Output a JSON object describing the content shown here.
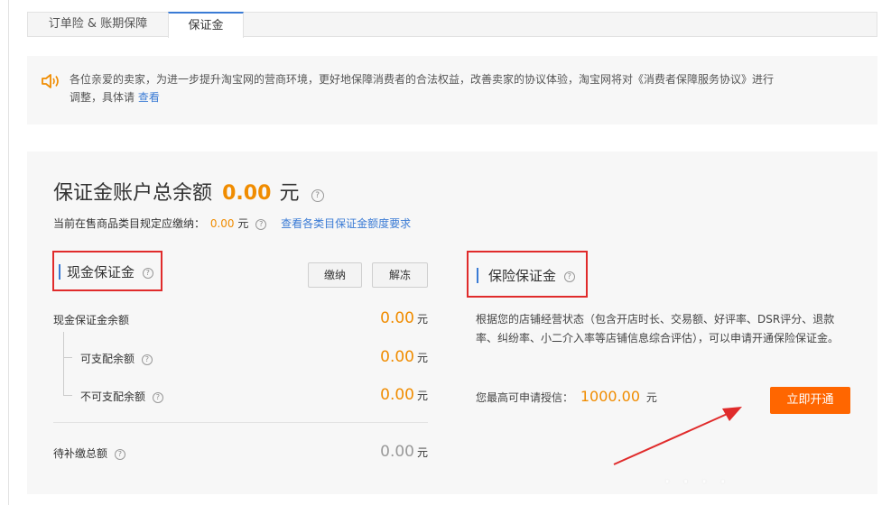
{
  "tabs": [
    {
      "label": "订单险 & 账期保障",
      "active": false
    },
    {
      "label": "保证金",
      "active": true
    }
  ],
  "notice": {
    "icon": "speaker-icon",
    "text": "各位亲爱的卖家，为进一步提升淘宝网的营商环境，更好地保障消费者的合法权益，改善卖家的协议体验，淘宝网将对《消费者保障服务协议》进行调整，具体请",
    "link": "查看"
  },
  "summary": {
    "title": "保证金账户总余额",
    "amount": "0.00",
    "unit": "元",
    "help_icon": "help-icon",
    "requirement_label": "当前在售商品类目规定应缴纳：",
    "requirement_amount": "0.00",
    "requirement_unit": "元",
    "requirement_link": "查看各类目保证金额度要求"
  },
  "cash": {
    "title": "现金保证金",
    "pay_button": "缴纳",
    "unfreeze_button": "解冻",
    "rows": [
      {
        "label": "现金保证金余额",
        "value": "0.00",
        "unit": "元"
      },
      {
        "label": "可支配余额",
        "value": "0.00",
        "unit": "元"
      },
      {
        "label": "不可支配余额",
        "value": "0.00",
        "unit": "元"
      },
      {
        "label": "待补缴总额",
        "value": "0.00",
        "unit": "元"
      }
    ]
  },
  "insurance": {
    "title": "保险保证金",
    "description": "根据您的店铺经营状态（包含开店时长、交易额、好评率、DSR评分、退款率、纠纷率、小二介入率等店铺信息综合评估），可以申请开通保险保证金。",
    "credit_label": "您最高可申请授信：",
    "credit_amount": "1000.00",
    "credit_unit": "元",
    "open_button": "立即开通"
  },
  "colors": {
    "accent_orange": "#f08c00",
    "button_orange": "#ff6600",
    "link_blue": "#3a7bd5",
    "highlight_red": "#e02b2b"
  }
}
